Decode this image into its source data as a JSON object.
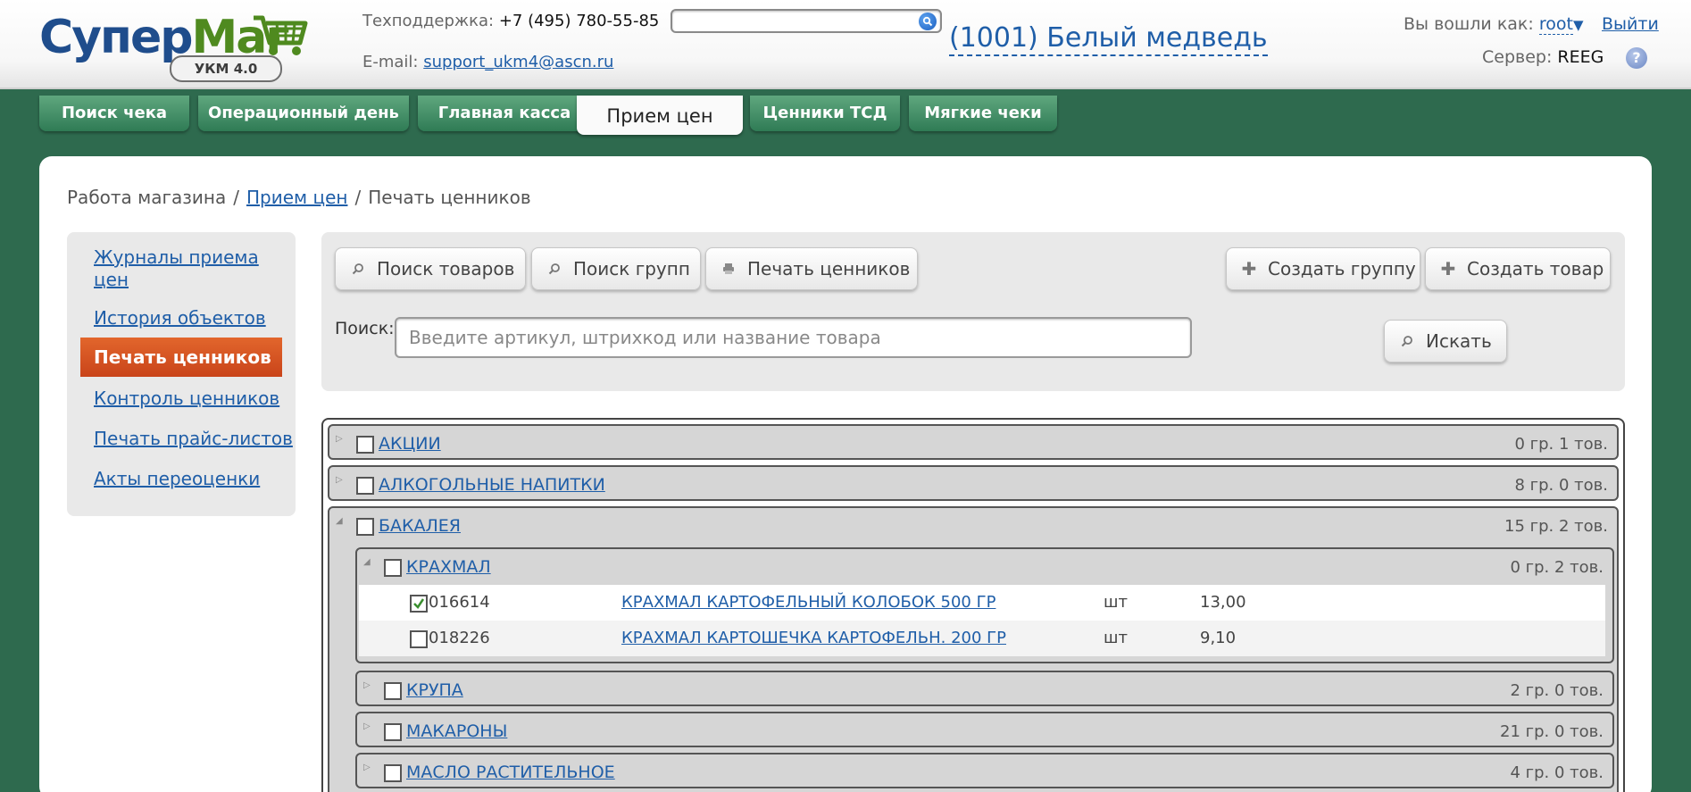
{
  "header": {
    "logo_part1": "Супер",
    "logo_part2": "Маг",
    "logo_badge": "УКМ 4.0",
    "support_label": "Техподдержка:",
    "support_phone": "+7 (495) 780-55-85",
    "email_label": "E-mail:",
    "email": "support_ukm4@ascn.ru",
    "search_value": "",
    "store": "(1001) Белый медведь",
    "login_label": "Вы вошли как:",
    "user": "root",
    "logout": "Выйти",
    "server_label": "Сервер:",
    "server": "REEG",
    "help": "?"
  },
  "tabs": [
    {
      "label": "Поиск чека"
    },
    {
      "label": "Операционный день"
    },
    {
      "label": "Главная касса"
    },
    {
      "label": "Прием цен"
    },
    {
      "label": "Ценники ТСД"
    },
    {
      "label": "Мягкие чеки"
    }
  ],
  "breadcrumb": {
    "root": "Работа магазина",
    "link": "Прием цен",
    "current": "Печать ценников"
  },
  "sidebar": {
    "items": [
      {
        "label": "Журналы приема цен"
      },
      {
        "label": "История объектов"
      },
      {
        "label": "Печать ценников"
      },
      {
        "label": "Контроль ценников"
      },
      {
        "label": "Печать прайс-листов"
      },
      {
        "label": "Акты переоценки"
      }
    ]
  },
  "toolbar": {
    "search_products": "Поиск товаров",
    "search_groups": "Поиск групп",
    "print_tags": "Печать ценников",
    "create_group": "Создать группу",
    "create_product": "Создать товар",
    "search_label": "Поиск:",
    "search_placeholder": "Введите артикул, штрихкод или название товара",
    "search_button": "Искать"
  },
  "tree": {
    "groups": [
      {
        "name": "АКЦИИ",
        "count": "0 гр. 1 тов."
      },
      {
        "name": "АЛКОГОЛЬНЫЕ НАПИТКИ",
        "count": "8 гр. 0 тов."
      },
      {
        "name": "БАКАЛЕЯ",
        "count": "15 гр. 2 тов."
      }
    ],
    "subgroups": [
      {
        "name": "КРАХМАЛ",
        "count": "0 гр. 2 тов."
      },
      {
        "name": "КРУПА",
        "count": "2 гр. 0 тов."
      },
      {
        "name": "МАКАРОНЫ",
        "count": "21 гр. 0 тов."
      },
      {
        "name": "МАСЛО РАСТИТЕЛЬНОЕ",
        "count": "4 гр. 0 тов."
      }
    ],
    "products": [
      {
        "code": "016614",
        "name": "КРАХМАЛ КАРТОФЕЛЬНЫЙ КОЛОБОК 500 ГР",
        "unit": "шт",
        "price": "13,00",
        "checked": true
      },
      {
        "code": "018226",
        "name": "КРАХМАЛ КАРТОШЕЧКА КАРТОФЕЛЬН. 200 ГР",
        "unit": "шт",
        "price": "9,10",
        "checked": false
      }
    ]
  },
  "colors": {
    "background": "#2e6a4e",
    "tab_green": "#3f8e63",
    "active_orange": "#d9532a",
    "link_blue": "#1f5ea8"
  }
}
